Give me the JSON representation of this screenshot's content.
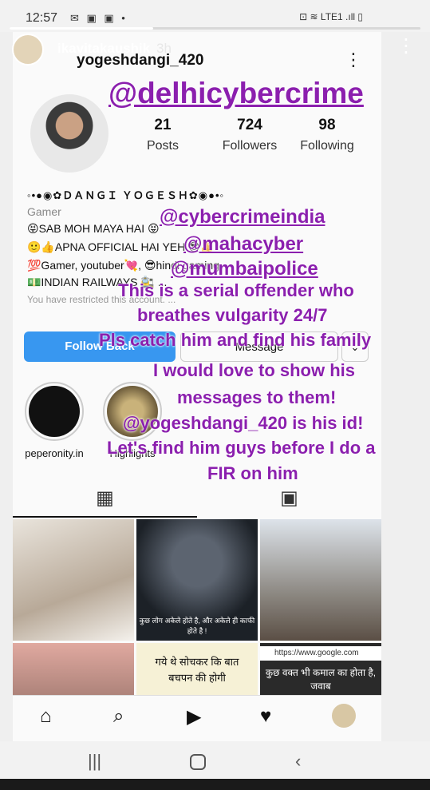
{
  "status_bar": {
    "time": "12:57",
    "notif_icons": "✉ ▣ ▣ •",
    "right_icons": "⊡ ≋ LTE1 .ıll ▯"
  },
  "story": {
    "username": "ikavitakaushik",
    "time": "3h",
    "progress": 0.35
  },
  "profile": {
    "username": "yogeshdangi_420",
    "stats": [
      {
        "value": "21",
        "label": "Posts"
      },
      {
        "value": "724",
        "label": "Followers"
      },
      {
        "value": "98",
        "label": "Following"
      }
    ],
    "display_name": "◦•●◉✿ＤＡＮＧＩ ＹＯＧＥＳＨ✿◉●•◦",
    "category": "Gamer",
    "bio": [
      "😝SAB MOH MAYA HAI 😝",
      "🙂👍APNA OFFICIAL HAI YEH 😎👍",
      "💯Gamer, youtuber💘, 😎hindi gaming",
      "💵INDIAN RAILWAYS 🚉 ..."
    ],
    "restricted_note": "You have restricted this account. ...",
    "follow_back_label": "Follow Back",
    "message_label": "Message",
    "more_label": "⌄",
    "highlights": [
      {
        "label": "peperonity.in"
      },
      {
        "label": "Highlights"
      }
    ]
  },
  "grid_captions": {
    "cell5": "कुछ लोग अकेले होते है, और अकेले ही काफी होते है !",
    "cell8_line1": "गये थे सोचकर कि बात",
    "cell8_line2": "बचपन की होगी",
    "cell9_url": "https://www.google.com",
    "cell9_text": "कुछ वक्त भी कमाल का होता है, जवाब"
  },
  "overlay": {
    "mention_main": "@delhicybercrime",
    "mention2": "@cybercrimeindia",
    "mention3": "@mahacyber",
    "mention4": "@mumbaipolice",
    "line1": "This is a serial offender who",
    "line2": "breathes vulgarity 24/7",
    "line3": "Pls catch him and find his family",
    "line4": "I would love to show his",
    "line5": "messages to them!",
    "line6": "@yogeshdangi_420 is his id!",
    "line7": "Let's find him guys before I do a",
    "line8": "FIR on him"
  },
  "colors": {
    "accent": "#8b1fae",
    "follow_button": "#3897f0"
  }
}
